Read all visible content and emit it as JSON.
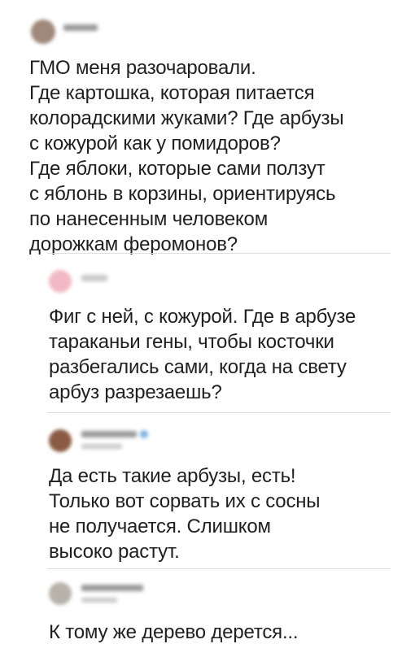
{
  "thread": {
    "posts": [
      {
        "author_hidden": true,
        "text": "ГМО меня разочаровали.\nГде картошка, которая питается\nколорадскими жуками? Где арбузы\nс кожурой как у помидоров?\nГде яблоки, которые сами ползут\nс яблонь в корзины, ориентируясь\nпо нанесенным человеком\nдорожкам феромонов?"
      },
      {
        "author_hidden": true,
        "text": "Фиг с ней, с кожурой. Где в арбузе\nтараканьи гены, чтобы косточки\nразбегались сами, когда на свету\nарбуз разрезаешь?"
      },
      {
        "author_hidden": true,
        "text": "Да есть такие арбузы, есть!\nТолько вот сорвать их с сосны\nне получается. Слишком\nвысоко растут."
      },
      {
        "author_hidden": true,
        "text": "К тому же дерево дерется..."
      }
    ]
  },
  "colors": {
    "text": "#1f1f1f",
    "divider": "#dddddd",
    "blur_name": "#9a9a9a",
    "blur_meta": "#c9c9c9",
    "avatar_1": "#a0897b",
    "avatar_2": "#f2b9c4",
    "avatar_3": "#8a5a43",
    "avatar_4": "#b7b2aa",
    "verified_badge": "#7ab0e0"
  }
}
